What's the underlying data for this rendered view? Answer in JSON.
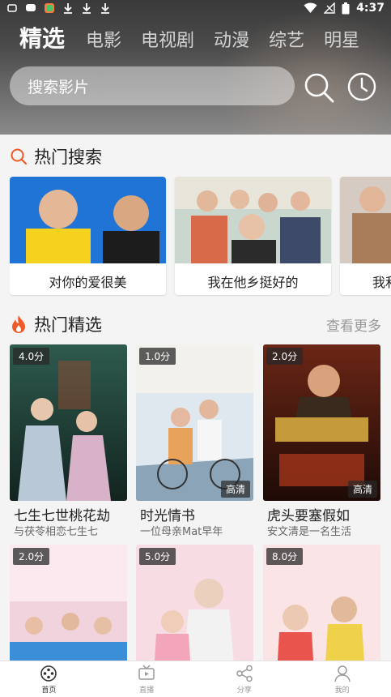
{
  "status_bar": {
    "time": "4:37"
  },
  "top_tabs": [
    {
      "label": "精选",
      "active": true
    },
    {
      "label": "电影",
      "active": false
    },
    {
      "label": "电视剧",
      "active": false
    },
    {
      "label": "动漫",
      "active": false
    },
    {
      "label": "综艺",
      "active": false
    },
    {
      "label": "明星",
      "active": false
    }
  ],
  "search": {
    "placeholder": "搜索影片"
  },
  "hot_search": {
    "title": "热门搜索",
    "items": [
      {
        "label": "对你的爱很美"
      },
      {
        "label": "我在他乡挺好的"
      },
      {
        "label": "我和"
      }
    ]
  },
  "hot_picks": {
    "title": "热门精选",
    "more": "查看更多",
    "items": [
      {
        "score": "4.0分",
        "badge": "",
        "title": "七生七世桃花劫",
        "desc": "与茯苓相恋七生七"
      },
      {
        "score": "1.0分",
        "badge": "高清",
        "title": "时光情书",
        "desc": "一位母亲Mat早年"
      },
      {
        "score": "2.0分",
        "badge": "高清",
        "title": "虎头要塞假如",
        "desc": "安文清是一名生活"
      },
      {
        "score": "2.0分",
        "badge": "",
        "title": "",
        "desc": ""
      },
      {
        "score": "5.0分",
        "badge": "",
        "title": "",
        "desc": ""
      },
      {
        "score": "8.0分",
        "badge": "",
        "title": "",
        "desc": ""
      }
    ]
  },
  "bottom_nav": [
    {
      "label": "首页",
      "icon": "home-film-icon",
      "active": true
    },
    {
      "label": "直播",
      "icon": "tv-icon",
      "active": false
    },
    {
      "label": "分享",
      "icon": "share-icon",
      "active": false
    },
    {
      "label": "我的",
      "icon": "user-icon",
      "active": false
    }
  ],
  "colors": {
    "accent": "#f05a28",
    "header_bg": "#4b4b4b"
  }
}
